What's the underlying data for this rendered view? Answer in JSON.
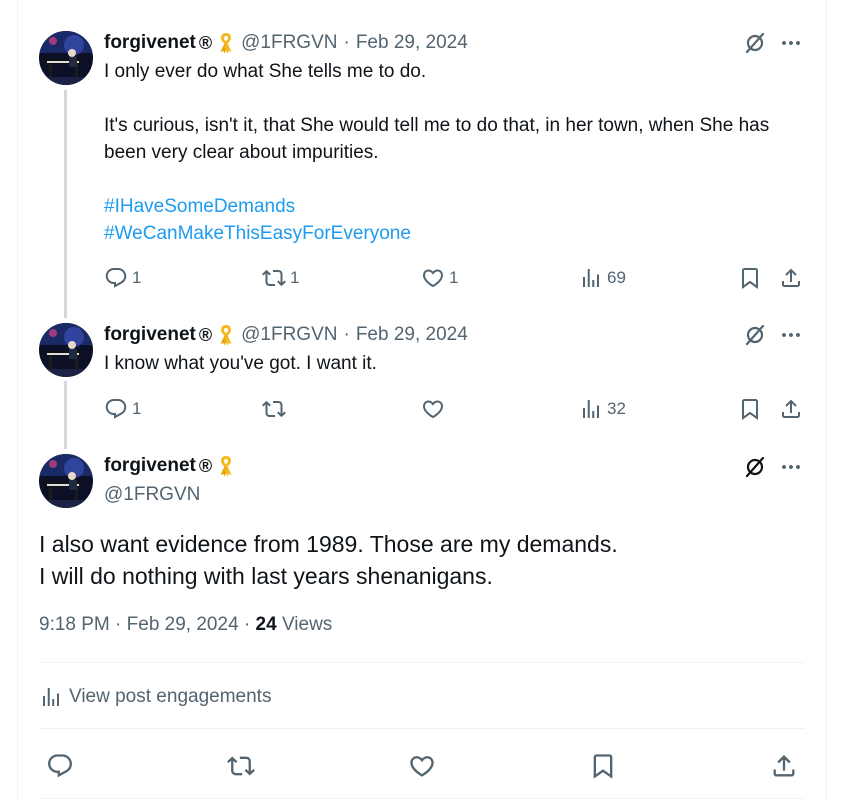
{
  "colors": {
    "text": "#0f1419",
    "secondary": "#536471",
    "link": "#1d9bf0",
    "thread_line": "#cfd9de"
  },
  "tweets": [
    {
      "name": "forgivenet",
      "reg": "®",
      "handle": "@1FRGVN",
      "sep": "·",
      "date": "Feb 29, 2024",
      "paragraphs": [
        "I only ever do what She tells me to do.",
        "It's curious, isn't it, that She would tell me to do that, in her town, when She has been very clear about impurities."
      ],
      "hashtags": [
        "#IHaveSomeDemands",
        "#WeCanMakeThisEasyForEveryone"
      ],
      "replies": "1",
      "reposts": "1",
      "likes": "1",
      "views": "69"
    },
    {
      "name": "forgivenet",
      "reg": "®",
      "handle": "@1FRGVN",
      "sep": "·",
      "date": "Feb 29, 2024",
      "paragraphs": [
        "I know what you've got. I want it."
      ],
      "replies": "1",
      "views": "32"
    }
  ],
  "main": {
    "name": "forgivenet",
    "reg": "®",
    "handle": "@1FRGVN",
    "lines": [
      "I also want evidence from 1989. Those are my demands.",
      "I will do nothing with last years shenanigans."
    ],
    "time": "9:18 PM",
    "dot": "·",
    "date": "Feb 29, 2024",
    "views_count": "24",
    "views_label": "Views",
    "engagements_label": "View post engagements"
  },
  "icons": [
    "grok-icon",
    "more-icon",
    "reply-icon",
    "repost-icon",
    "like-icon",
    "views-icon",
    "bookmark-icon",
    "share-icon",
    "ribbon-icon"
  ]
}
